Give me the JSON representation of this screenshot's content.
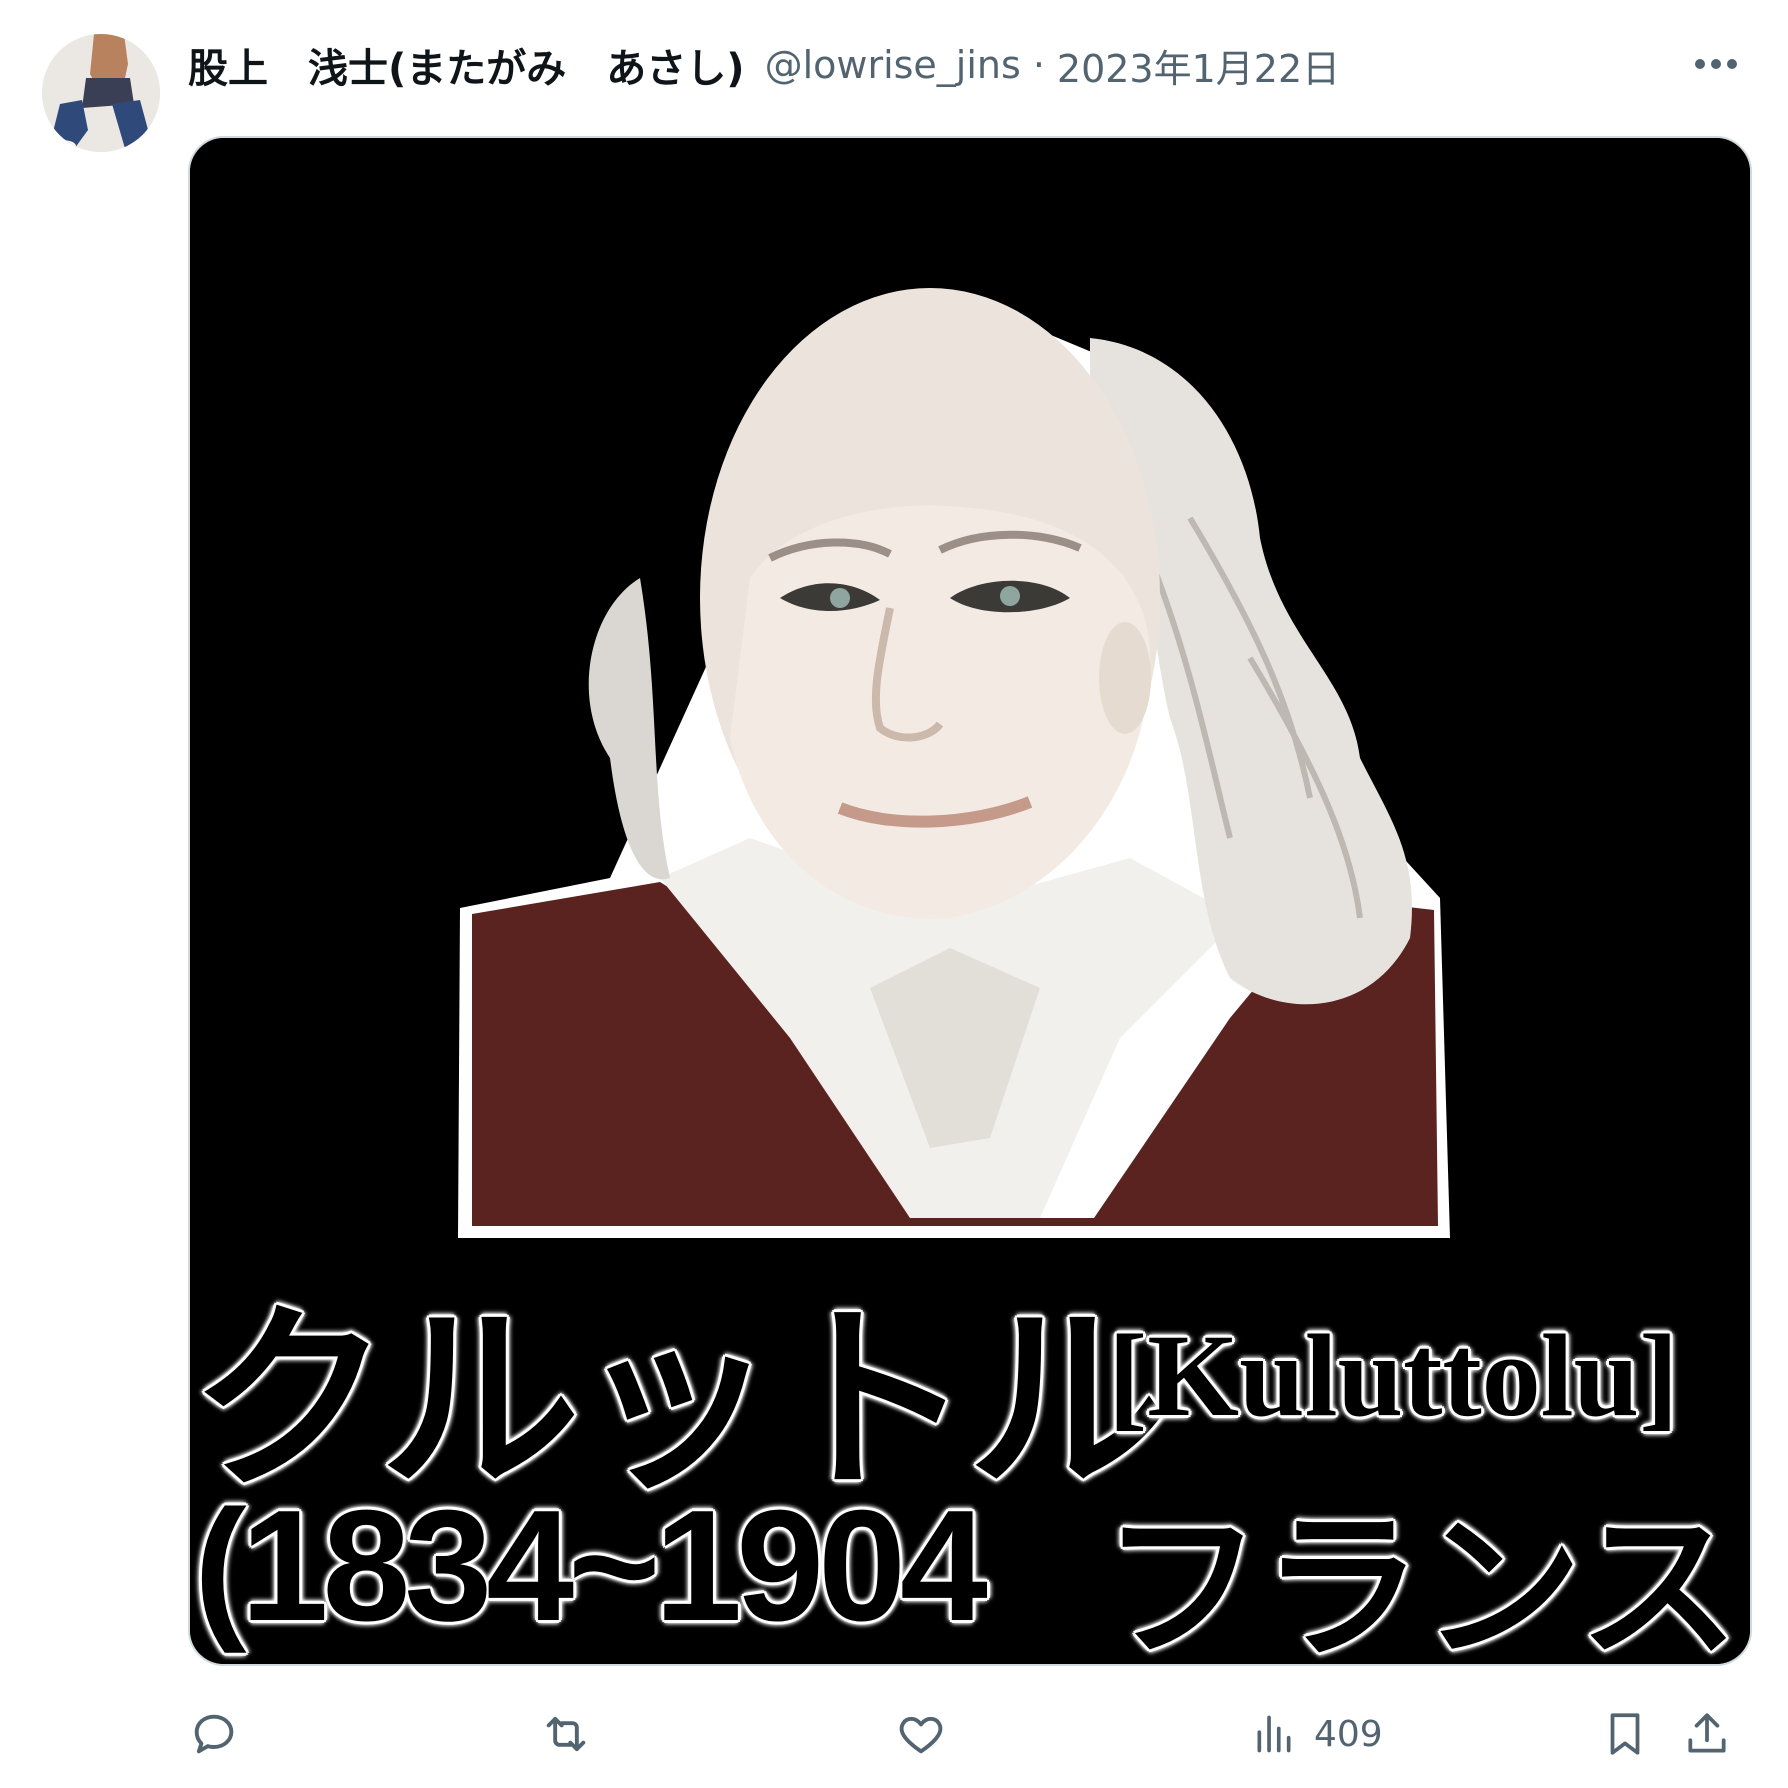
{
  "post": {
    "display_name": "股上　浅士(またがみ　あさし)",
    "handle": "@lowrise_jins",
    "separator": "·",
    "date": "2023年1月22日"
  },
  "image": {
    "caption_katakana": "クルットル",
    "caption_romaji": "[Kuluttolu]",
    "caption_years": "(1834~1904",
    "caption_country": "フランス )",
    "colors": {
      "background": "#000000",
      "coat": "#5a2320",
      "hair": "#e6e3df",
      "skin": "#ece4dc"
    }
  },
  "actions": {
    "reply_icon": "reply-icon",
    "retweet_icon": "retweet-icon",
    "like_icon": "heart-icon",
    "views_icon": "bar-chart-icon",
    "views_count": "409",
    "bookmark_icon": "bookmark-icon",
    "share_icon": "share-icon"
  },
  "colors": {
    "text_primary": "#0f1419",
    "text_secondary": "#536471",
    "border": "#cfd9de"
  }
}
